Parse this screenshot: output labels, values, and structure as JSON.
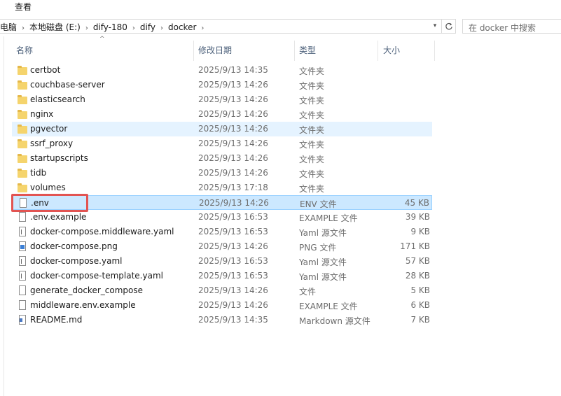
{
  "menubar": {
    "view_label": "查看"
  },
  "address": {
    "crumbs": [
      "此电脑",
      "本地磁盘 (E:)",
      "dify-180",
      "dify",
      "docker"
    ]
  },
  "search": {
    "placeholder": "在 docker 中搜索"
  },
  "columns": {
    "name": "名称",
    "date": "修改日期",
    "type": "类型",
    "size": "大小"
  },
  "files": [
    {
      "name": "certbot",
      "date": "2025/9/13 14:35",
      "type": "文件夹",
      "size": "",
      "icon": "folder-icon"
    },
    {
      "name": "couchbase-server",
      "date": "2025/9/13 14:26",
      "type": "文件夹",
      "size": "",
      "icon": "folder-icon"
    },
    {
      "name": "elasticsearch",
      "date": "2025/9/13 14:26",
      "type": "文件夹",
      "size": "",
      "icon": "folder-icon"
    },
    {
      "name": "nginx",
      "date": "2025/9/13 14:26",
      "type": "文件夹",
      "size": "",
      "icon": "folder-icon"
    },
    {
      "name": "pgvector",
      "date": "2025/9/13 14:26",
      "type": "文件夹",
      "size": "",
      "icon": "folder-icon"
    },
    {
      "name": "ssrf_proxy",
      "date": "2025/9/13 14:26",
      "type": "文件夹",
      "size": "",
      "icon": "folder-icon"
    },
    {
      "name": "startupscripts",
      "date": "2025/9/13 14:26",
      "type": "文件夹",
      "size": "",
      "icon": "folder-icon"
    },
    {
      "name": "tidb",
      "date": "2025/9/13 14:26",
      "type": "文件夹",
      "size": "",
      "icon": "folder-icon"
    },
    {
      "name": "volumes",
      "date": "2025/9/13 17:18",
      "type": "文件夹",
      "size": "",
      "icon": "folder-icon"
    },
    {
      "name": ".env",
      "date": "2025/9/13 14:26",
      "type": "ENV 文件",
      "size": "45 KB",
      "icon": "file-icon"
    },
    {
      "name": ".env.example",
      "date": "2025/9/13 16:53",
      "type": "EXAMPLE 文件",
      "size": "39 KB",
      "icon": "file-icon"
    },
    {
      "name": "docker-compose.middleware.yaml",
      "date": "2025/9/13 16:53",
      "type": "Yaml 源文件",
      "size": "9 KB",
      "icon": "yaml-file-icon"
    },
    {
      "name": "docker-compose.png",
      "date": "2025/9/13 14:26",
      "type": "PNG 文件",
      "size": "171 KB",
      "icon": "image-file-icon"
    },
    {
      "name": "docker-compose.yaml",
      "date": "2025/9/13 16:53",
      "type": "Yaml 源文件",
      "size": "57 KB",
      "icon": "yaml-file-icon"
    },
    {
      "name": "docker-compose-template.yaml",
      "date": "2025/9/13 16:53",
      "type": "Yaml 源文件",
      "size": "28 KB",
      "icon": "yaml-file-icon"
    },
    {
      "name": "generate_docker_compose",
      "date": "2025/9/13 14:26",
      "type": "文件",
      "size": "5 KB",
      "icon": "file-icon"
    },
    {
      "name": "middleware.env.example",
      "date": "2025/9/13 14:26",
      "type": "EXAMPLE 文件",
      "size": "6 KB",
      "icon": "file-icon"
    },
    {
      "name": "README.md",
      "date": "2025/9/13 14:35",
      "type": "Markdown 源文件",
      "size": "7 KB",
      "icon": "markdown-file-icon"
    }
  ],
  "hovered_file": "pgvector",
  "selected_file": ".env",
  "colors": {
    "folder": "#f5d46d",
    "selection": "#cce8ff",
    "hover": "#e5f3ff",
    "highlight_box": "#e25452",
    "header_text": "#4c607a"
  }
}
